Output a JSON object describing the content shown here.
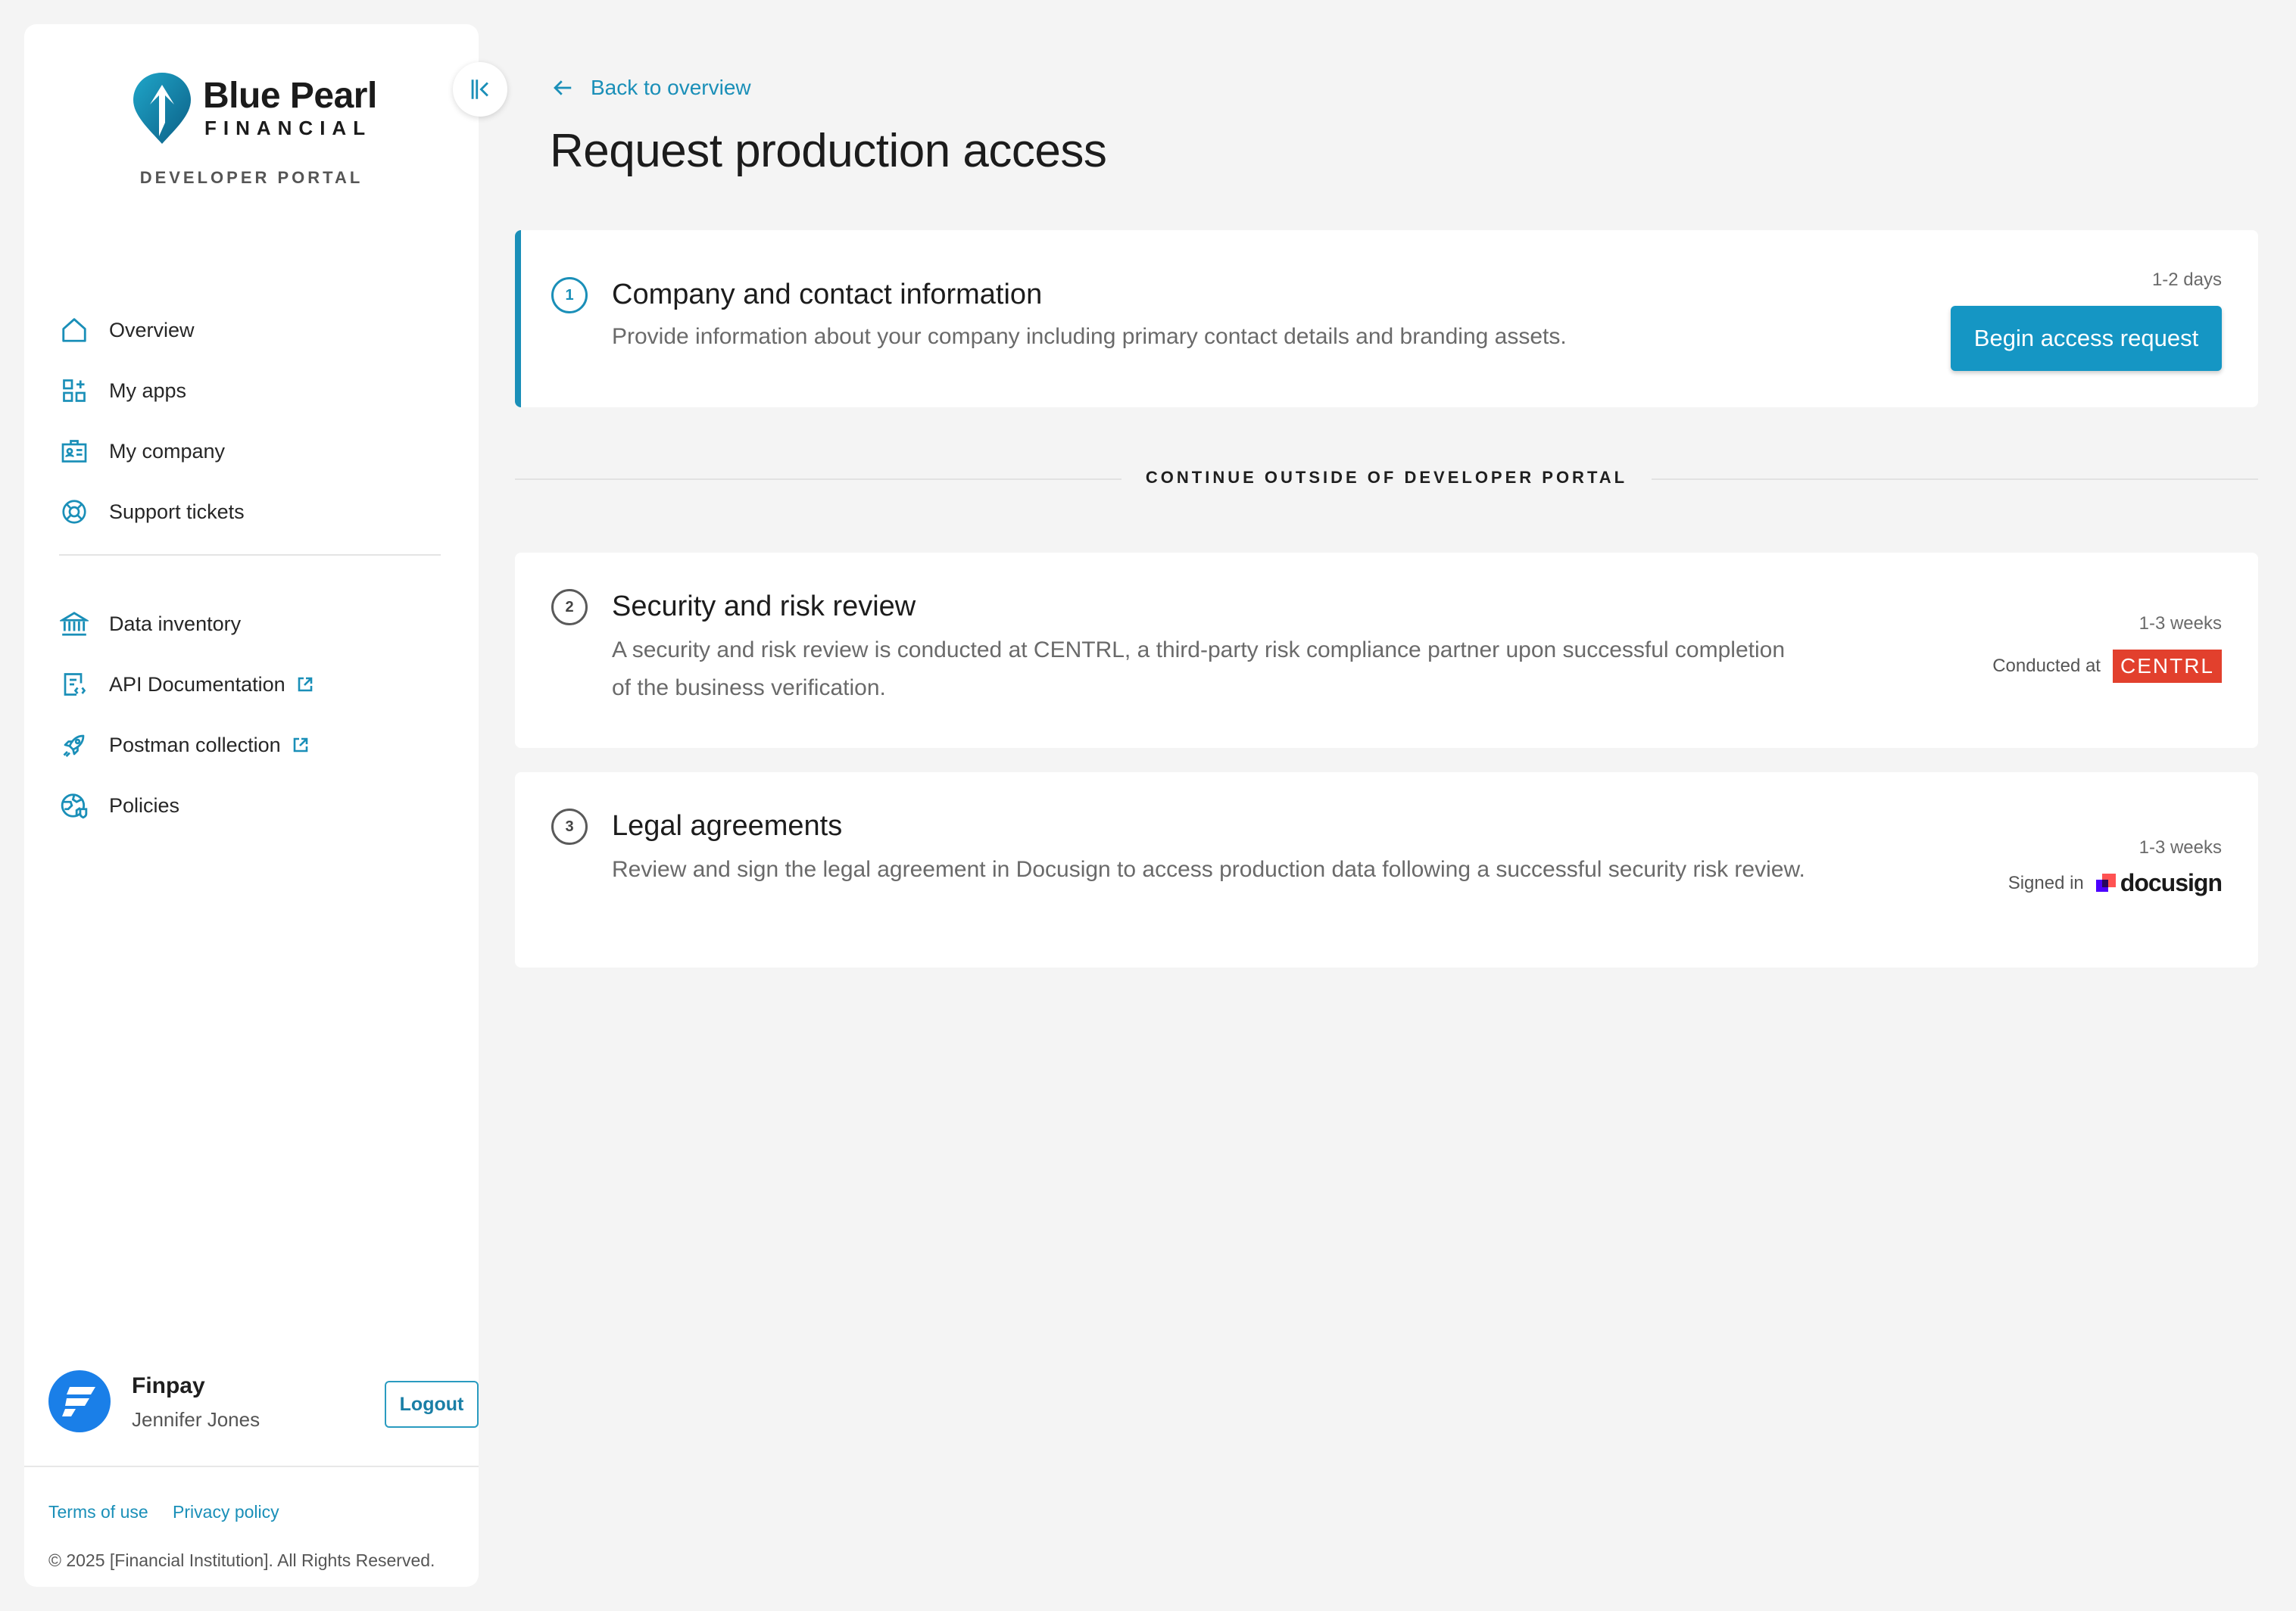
{
  "brand": {
    "name": "Blue Pearl",
    "sub": "FINANCIAL",
    "portal": "DEVELOPER PORTAL",
    "accent": "#1a8fb8"
  },
  "sidebar": {
    "primary": [
      {
        "label": "Overview",
        "icon": "home-icon"
      },
      {
        "label": "My apps",
        "icon": "apps-icon"
      },
      {
        "label": "My company",
        "icon": "company-icon"
      },
      {
        "label": "Support tickets",
        "icon": "lifebuoy-icon"
      }
    ],
    "secondary": [
      {
        "label": "Data inventory",
        "icon": "bank-icon"
      },
      {
        "label": "API Documentation",
        "icon": "code-doc-icon",
        "external": true
      },
      {
        "label": "Postman collection",
        "icon": "rocket-icon",
        "external": true
      },
      {
        "label": "Policies",
        "icon": "globe-icon"
      }
    ]
  },
  "user": {
    "company": "Finpay",
    "name": "Jennifer Jones",
    "logout_label": "Logout"
  },
  "footer": {
    "terms": "Terms of use",
    "privacy": "Privacy policy",
    "copyright": "© 2025 [Financial Institution]. All Rights Reserved."
  },
  "main": {
    "back_label": "Back to overview",
    "title": "Request production access",
    "separator_label": "CONTINUE OUTSIDE OF DEVELOPER PORTAL",
    "steps": [
      {
        "number": "1",
        "title": "Company and contact information",
        "description": "Provide information about your company including primary contact details and branding assets.",
        "duration": "1-2 days",
        "action_label": "Begin access request"
      },
      {
        "number": "2",
        "title": "Security and risk review",
        "description": "A security and risk review is conducted at CENTRL, a third-party risk compliance partner upon successful completion of the business verification.",
        "duration": "1-3 weeks",
        "partner_prefix": "Conducted at",
        "partner_name": "CENTRL"
      },
      {
        "number": "3",
        "title": "Legal agreements",
        "description": "Review and sign the legal agreement in Docusign to access production data following a successful security risk review.",
        "duration": "1-3 weeks",
        "partner_prefix": "Signed in",
        "partner_name": "docusign"
      }
    ]
  }
}
